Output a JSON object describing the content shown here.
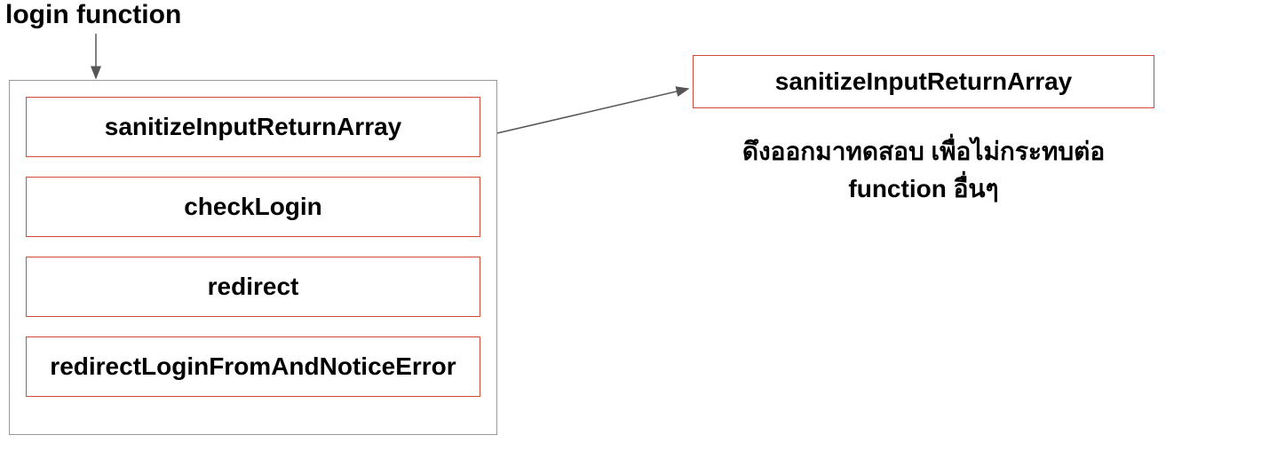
{
  "title": "login function",
  "container": {
    "items": [
      {
        "label": "sanitizeInputReturnArray"
      },
      {
        "label": "checkLogin"
      },
      {
        "label": "redirect"
      },
      {
        "label": "redirectLoginFromAndNoticeError"
      }
    ]
  },
  "extracted": {
    "label": "sanitizeInputReturnArray",
    "caption_line1": "ดึงออกมาทดสอบ เพื่อไม่กระทบต่อ",
    "caption_line2": "function อื่นๆ"
  }
}
